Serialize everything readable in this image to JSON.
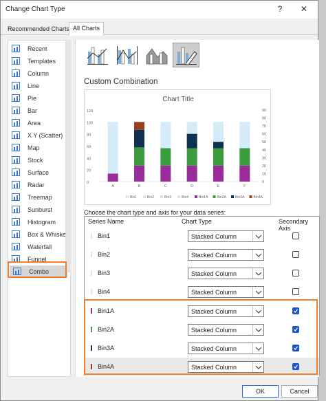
{
  "window": {
    "title": "Change Chart Type",
    "help": "?",
    "close": "✕"
  },
  "tabs": [
    {
      "label": "Recommended Charts"
    },
    {
      "label": "All Charts"
    }
  ],
  "nav": [
    {
      "label": "Recent",
      "icon": "recent-icon"
    },
    {
      "label": "Templates",
      "icon": "templates-icon"
    },
    {
      "label": "Column",
      "icon": "column-icon"
    },
    {
      "label": "Line",
      "icon": "line-icon"
    },
    {
      "label": "Pie",
      "icon": "pie-icon"
    },
    {
      "label": "Bar",
      "icon": "bar-icon"
    },
    {
      "label": "Area",
      "icon": "area-icon"
    },
    {
      "label": "X Y (Scatter)",
      "icon": "scatter-icon"
    },
    {
      "label": "Map",
      "icon": "map-icon"
    },
    {
      "label": "Stock",
      "icon": "stock-icon"
    },
    {
      "label": "Surface",
      "icon": "surface-icon"
    },
    {
      "label": "Radar",
      "icon": "radar-icon"
    },
    {
      "label": "Treemap",
      "icon": "treemap-icon"
    },
    {
      "label": "Sunburst",
      "icon": "sunburst-icon"
    },
    {
      "label": "Histogram",
      "icon": "histogram-icon"
    },
    {
      "label": "Box & Whisker",
      "icon": "box-whisker-icon"
    },
    {
      "label": "Waterfall",
      "icon": "waterfall-icon"
    },
    {
      "label": "Funnel",
      "icon": "funnel-icon"
    },
    {
      "label": "Combo",
      "icon": "combo-icon",
      "selected": true
    }
  ],
  "combo_types": [
    {
      "icon": "clustered-column-line-icon"
    },
    {
      "icon": "clustered-column-line-secondary-icon"
    },
    {
      "icon": "stacked-area-column-icon"
    },
    {
      "icon": "custom-combination-icon",
      "selected": true
    }
  ],
  "section_title": "Custom Combination",
  "chart_data": {
    "type": "bar",
    "title": "Chart Title",
    "categories": [
      "A",
      "B",
      "C",
      "D",
      "E",
      "F"
    ],
    "left_axis": {
      "ticks": [
        "120",
        "100",
        "80",
        "60",
        "40",
        "20",
        "0"
      ],
      "ylim": [
        0,
        120
      ]
    },
    "right_axis": {
      "ticks": [
        "90",
        "80",
        "70",
        "60",
        "50",
        "40",
        "30",
        "20",
        "10",
        "0"
      ],
      "ylim": [
        0,
        90
      ]
    },
    "background_stack_total": 100,
    "series": [
      {
        "name": "Bin1",
        "color": "#cfe8f7",
        "values": []
      },
      {
        "name": "Bin2",
        "color": "#cfe8f7",
        "values": []
      },
      {
        "name": "Bin3",
        "color": "#cfe8f7",
        "values": []
      },
      {
        "name": "Bin4",
        "color": "#cfe8f7",
        "values": []
      },
      {
        "name": "Bin1A",
        "color": "#9a2b9b",
        "values": [
          10,
          20,
          20,
          20,
          20,
          20
        ],
        "axis": "secondary"
      },
      {
        "name": "Bin2A",
        "color": "#3a9c3c",
        "values": [
          0,
          23,
          22,
          22,
          22,
          22
        ],
        "axis": "secondary"
      },
      {
        "name": "Bin3A",
        "color": "#0f3050",
        "values": [
          0,
          22,
          0,
          18,
          8,
          0
        ],
        "axis": "secondary"
      },
      {
        "name": "Bin4A",
        "color": "#9b3e1b",
        "values": [
          0,
          10,
          0,
          0,
          0,
          0
        ],
        "axis": "secondary"
      }
    ],
    "legend": [
      "Bin1",
      "Bin2",
      "Bin3",
      "Bin4",
      "Bin1A",
      "Bin2A",
      "Bin3A",
      "Bin4A"
    ],
    "legend_position": "bottom"
  },
  "series_caption": "Choose the chart type and axis for your data series:",
  "grid": {
    "headers": {
      "name": "Series Name",
      "type": "Chart Type",
      "secondary": "Secondary Axis"
    },
    "rows": [
      {
        "name": "Bin1",
        "type": "Stacked Column",
        "secondary": false,
        "color": "#cfe8f7"
      },
      {
        "name": "Bin2",
        "type": "Stacked Column",
        "secondary": false,
        "color": "#cfe8f7"
      },
      {
        "name": "Bin3",
        "type": "Stacked Column",
        "secondary": false,
        "color": "#cfe8f7"
      },
      {
        "name": "Bin4",
        "type": "Stacked Column",
        "secondary": false,
        "color": "#cfe8f7"
      },
      {
        "name": "Bin1A",
        "type": "Stacked Column",
        "secondary": true,
        "color": "#9a2b9b"
      },
      {
        "name": "Bin2A",
        "type": "Stacked Column",
        "secondary": true,
        "color": "#3a9c3c"
      },
      {
        "name": "Bin3A",
        "type": "Stacked Column",
        "secondary": true,
        "color": "#0f3050"
      },
      {
        "name": "Bin4A",
        "type": "Stacked Column",
        "secondary": true,
        "color": "#9b3e1b"
      }
    ]
  },
  "footer": {
    "ok": "OK",
    "cancel": "Cancel"
  },
  "colors": {
    "highlight": "#ef7d2a",
    "accent": "#1a56c7"
  }
}
